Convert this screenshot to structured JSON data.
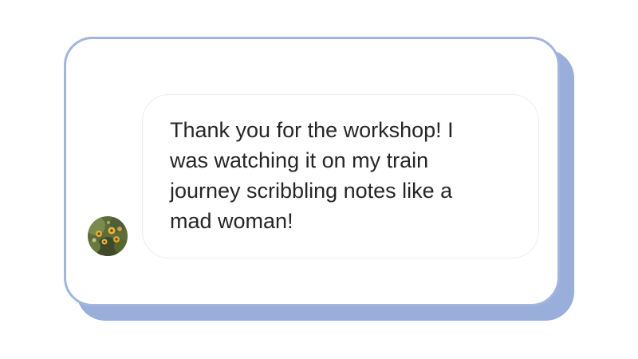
{
  "comment": {
    "avatar_icon": "avatar-flower-photo",
    "message_lines": "Thank you for the workshop! I\nwas watching it on my train\njourney scribbling notes like a\nmad woman!"
  },
  "colors": {
    "card_border": "#a3b5de",
    "card_shadow": "#9aaedb",
    "bubble_background": "#ffffff",
    "text": "#262626"
  }
}
